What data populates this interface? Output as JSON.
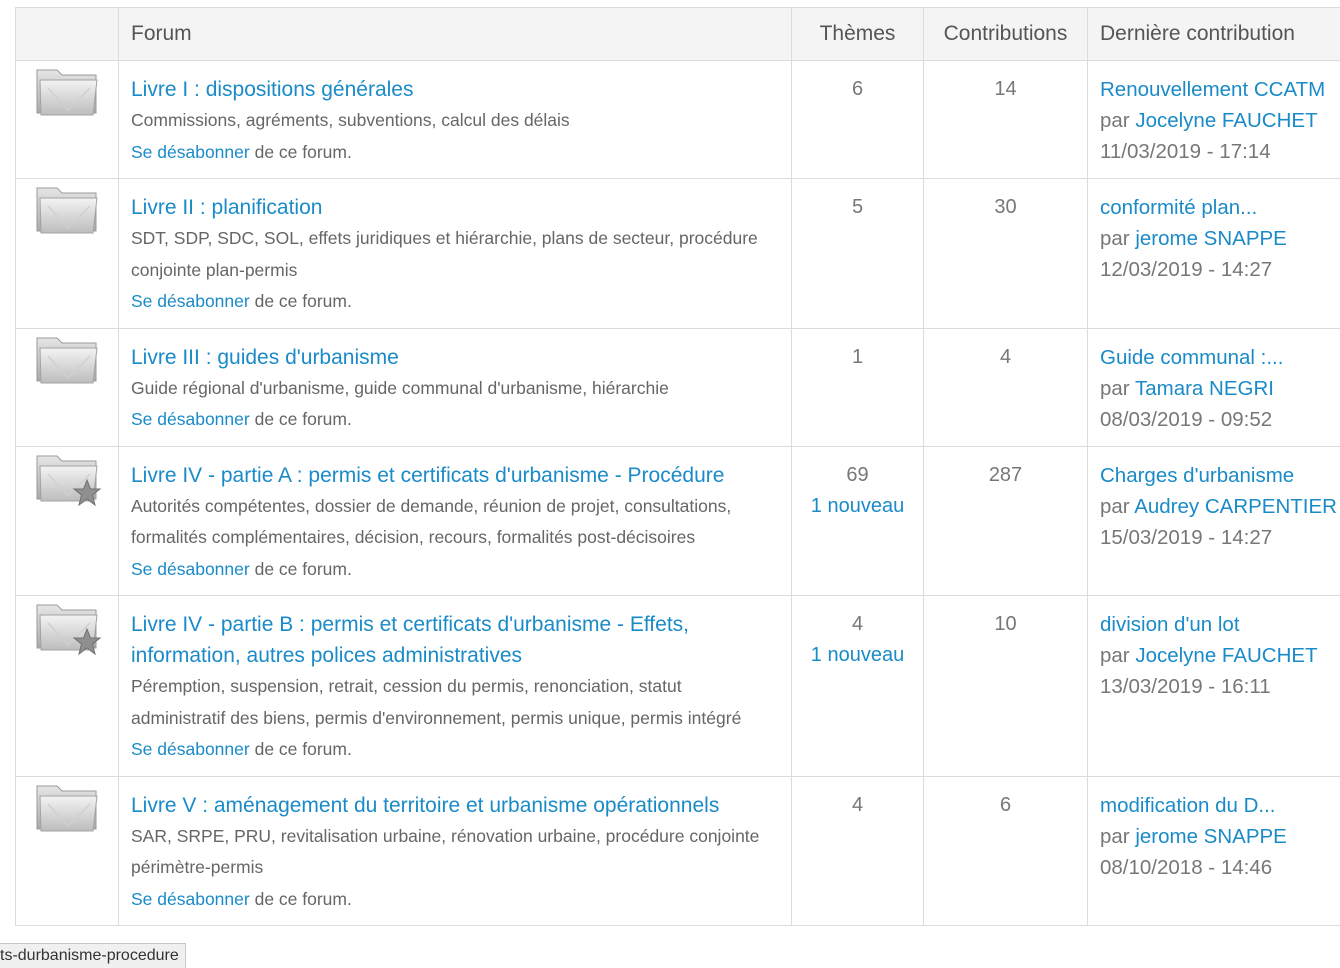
{
  "header": {
    "forum": "Forum",
    "themes": "Thèmes",
    "contributions": "Contributions",
    "last_contribution": "Dernière contribution"
  },
  "rows": [
    {
      "icon": "folder-icon",
      "title": "Livre I : dispositions générales",
      "description": "Commissions, agréments, subventions, calcul des délais",
      "unsubscribe_link": "Se désabonner",
      "unsubscribe_suffix": " de ce forum.",
      "themes": "6",
      "new": "",
      "contributions": "14",
      "last_title": "Renouvellement CCATM",
      "last_by": "par ",
      "last_author": "Jocelyne FAUCHET",
      "last_date": "11/03/2019 - 17:14"
    },
    {
      "icon": "folder-icon",
      "title": "Livre II : planification",
      "description": "SDT, SDP, SDC, SOL, effets juridiques et hiérarchie, plans de secteur, procédure conjointe plan-permis",
      "unsubscribe_link": "Se désabonner",
      "unsubscribe_suffix": " de ce forum.",
      "themes": "5",
      "new": "",
      "contributions": "30",
      "last_title": "conformité plan...",
      "last_by": "par ",
      "last_author": "jerome SNAPPE",
      "last_date": "12/03/2019 - 14:27"
    },
    {
      "icon": "folder-icon",
      "title": "Livre III : guides d'urbanisme",
      "description": "Guide régional d'urbanisme, guide communal d'urbanisme, hiérarchie",
      "unsubscribe_link": "Se désabonner",
      "unsubscribe_suffix": " de ce forum.",
      "themes": "1",
      "new": "",
      "contributions": "4",
      "last_title": "Guide communal :...",
      "last_by": "par ",
      "last_author": "Tamara NEGRI",
      "last_date": "08/03/2019 - 09:52"
    },
    {
      "icon": "folder-star-icon",
      "title": "Livre IV - partie A : permis et certificats d'urbanisme - Procédure",
      "description": "Autorités compétentes, dossier de demande, réunion de projet, consultations, formalités complémentaires, décision, recours, formalités post-décisoires",
      "unsubscribe_link": "Se désabonner",
      "unsubscribe_suffix": " de ce forum.",
      "themes": "69",
      "new": "1 nouveau",
      "contributions": "287",
      "last_title": "Charges d'urbanisme",
      "last_by": "par ",
      "last_author": "Audrey CARPENTIER",
      "last_date": "15/03/2019 - 14:27"
    },
    {
      "icon": "folder-star-icon",
      "title": "Livre IV - partie B : permis et certificats d'urbanisme - Effets, information, autres polices administratives",
      "description": "Péremption, suspension, retrait, cession du permis, renonciation, statut administratif des biens, permis d'environnement, permis unique, permis intégré",
      "unsubscribe_link": "Se désabonner",
      "unsubscribe_suffix": " de ce forum.",
      "themes": "4",
      "new": "1 nouveau",
      "contributions": "10",
      "last_title": "division d'un lot",
      "last_by": "par ",
      "last_author": "Jocelyne FAUCHET",
      "last_date": "13/03/2019 - 16:11"
    },
    {
      "icon": "folder-icon",
      "title": "Livre V : aménagement du territoire et urbanisme opérationnels",
      "description": "SAR, SRPE, PRU, revitalisation urbaine, rénovation urbaine, procédure conjointe périmètre-permis",
      "unsubscribe_link": "Se désabonner",
      "unsubscribe_suffix": " de ce forum.",
      "themes": "4",
      "new": "",
      "contributions": "6",
      "last_title": "modification du D...",
      "last_by": "par ",
      "last_author": "jerome SNAPPE",
      "last_date": "08/10/2018 - 14:46"
    }
  ],
  "status_bar": "ts-durbanisme-procedure",
  "colors": {
    "link": "#1a8bc8",
    "text": "#666666",
    "header_bg": "#f4f4f4",
    "border": "#dcdcdc"
  }
}
